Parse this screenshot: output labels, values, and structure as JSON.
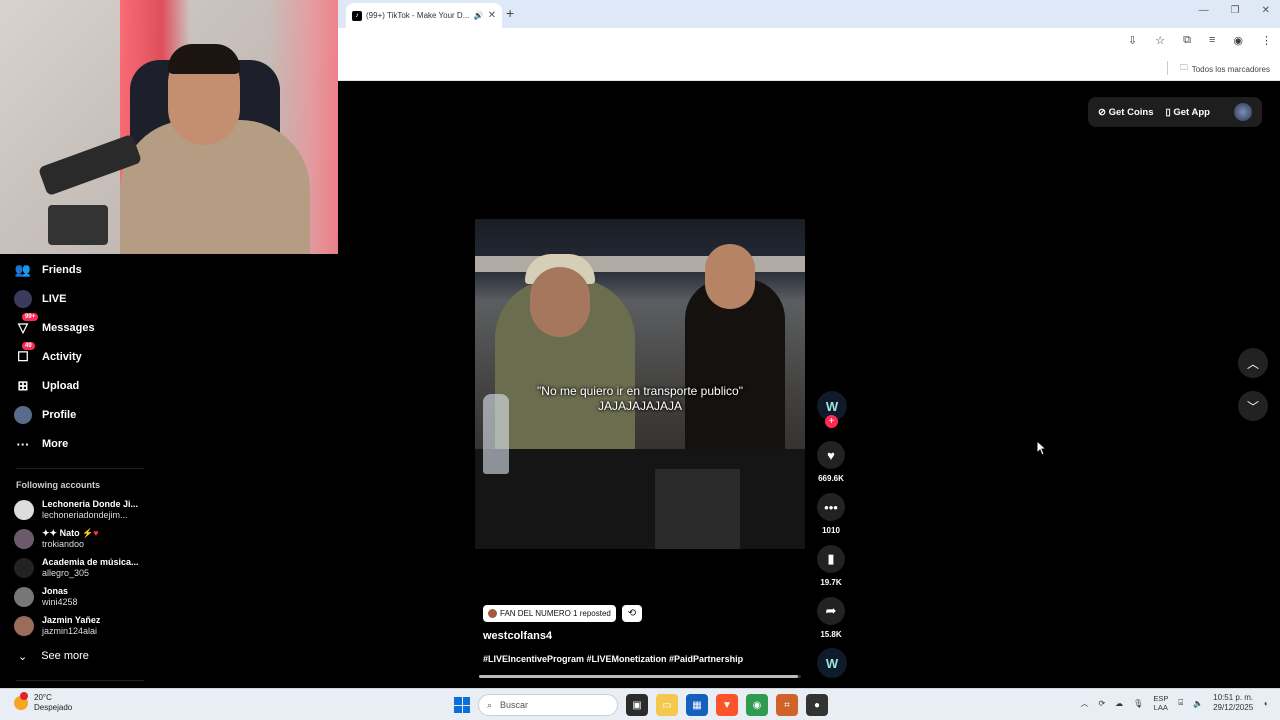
{
  "browser": {
    "tab_title": "(99+) TikTok - Make Your D...",
    "new_tab_symbol": "+",
    "bookmarks_label": "Todos los marcadores"
  },
  "tiktok": {
    "header": {
      "get_coins": "Get Coins",
      "get_app": "Get App"
    },
    "sidebar": {
      "items": [
        {
          "label": "Friends",
          "icon": "friends-icon"
        },
        {
          "label": "LIVE",
          "icon": "live-icon"
        },
        {
          "label": "Messages",
          "icon": "messages-icon",
          "badge": "99+"
        },
        {
          "label": "Activity",
          "icon": "activity-icon",
          "badge": "49"
        },
        {
          "label": "Upload",
          "icon": "upload-icon"
        },
        {
          "label": "Profile",
          "icon": "profile-icon"
        },
        {
          "label": "More",
          "icon": "more-icon"
        }
      ],
      "following_title": "Following accounts",
      "following": [
        {
          "name": "Lechoneria Donde Ji...",
          "handle": "lechoneriadondejim..."
        },
        {
          "name": "Nato",
          "handle": "trokiandoo"
        },
        {
          "name": "Academia de música...",
          "handle": "allegro_305"
        },
        {
          "name": "Jonas",
          "handle": "wini4258"
        },
        {
          "name": "Jazmin Yañez",
          "handle": "jazmin124alai"
        }
      ],
      "see_more": "See more"
    },
    "video": {
      "caption_line1": "\"No me quiero ir en transporte publico\"",
      "caption_line2": "JAJAJAJAJAJA",
      "repost_text": "FAN DEL NUMERO 1 reposted",
      "author": "westcolfans4",
      "tags": "#LIVEIncentiveProgram #LIVEMonetization #PaidPartnership",
      "progress": 0.99
    },
    "actions": {
      "likes": "669.6K",
      "comments": "1010",
      "saves": "19.7K",
      "shares": "15.8K"
    }
  },
  "taskbar": {
    "weather_temp": "20°C",
    "weather_desc": "Despejado",
    "search_placeholder": "Buscar",
    "lang_line1": "ESP",
    "lang_line2": "LAA",
    "time": "10:51 p. m.",
    "date": "29/12/2025"
  }
}
